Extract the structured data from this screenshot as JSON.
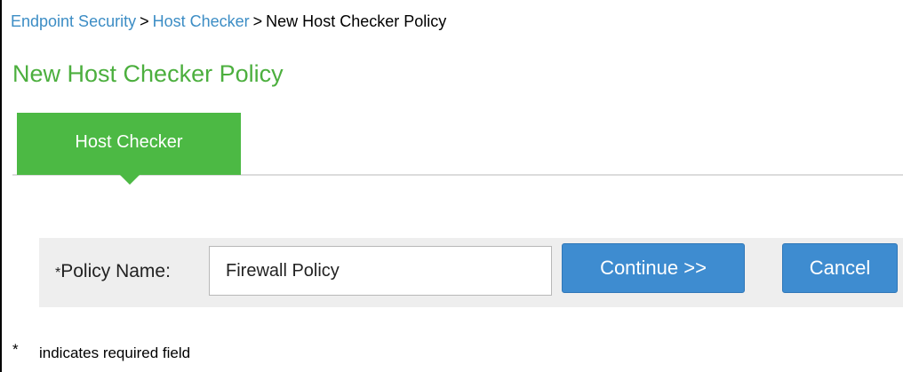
{
  "breadcrumb": {
    "items": [
      "Endpoint Security",
      "Host Checker"
    ],
    "separator": ">",
    "current": "New Host Checker Policy"
  },
  "page": {
    "title": "New Host Checker Policy"
  },
  "tabs": [
    {
      "label": "Host Checker",
      "active": true
    }
  ],
  "form": {
    "required_marker": "*",
    "policy_name_label": "Policy Name:",
    "policy_name_value": "Firewall Policy",
    "continue_label": "Continue >>",
    "cancel_label": "Cancel"
  },
  "footnote": {
    "marker": "*",
    "text": "indicates required field"
  },
  "colors": {
    "link": "#3c8dc5",
    "title_green": "#4caf3e",
    "tab_green": "#4cb944",
    "button_blue": "#3e8cd0",
    "row_bg": "#eeeeee"
  }
}
